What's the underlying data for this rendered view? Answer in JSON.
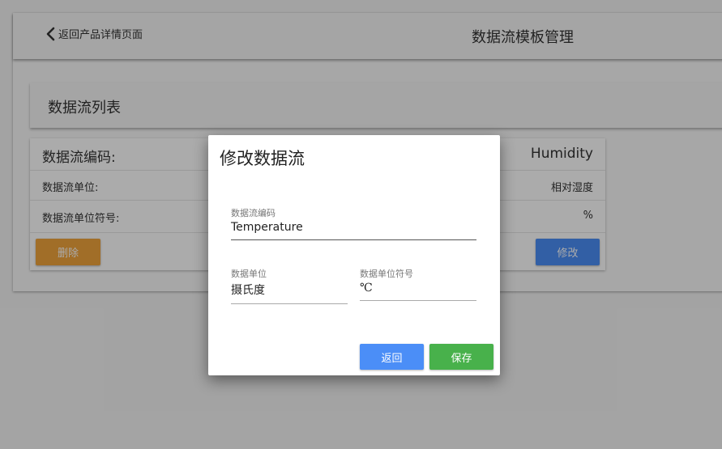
{
  "header": {
    "back_label": "返回产品详情页面",
    "title": "数据流模板管理"
  },
  "list": {
    "title": "数据流列表"
  },
  "datastream_card": {
    "code_label": "数据流编码:",
    "code_value": "Humidity",
    "unit_label": "数据流单位:",
    "unit_value": "相对湿度",
    "symbol_label": "数据流单位符号:",
    "symbol_value": "%",
    "delete_label": "删除",
    "edit_label": "修改"
  },
  "dialog": {
    "title": "修改数据流",
    "code_field": {
      "label": "数据流编码",
      "value": "Temperature"
    },
    "unit_field": {
      "label": "数据单位",
      "value": "摄氏度"
    },
    "symbol_field": {
      "label": "数据单位符号",
      "value": "℃"
    },
    "back_label": "返回",
    "save_label": "保存"
  },
  "colors": {
    "primary": "#4b8ef7",
    "warning": "#f0a53c",
    "success": "#48b14b"
  },
  "icons": {
    "back": "chevron-left-icon"
  }
}
